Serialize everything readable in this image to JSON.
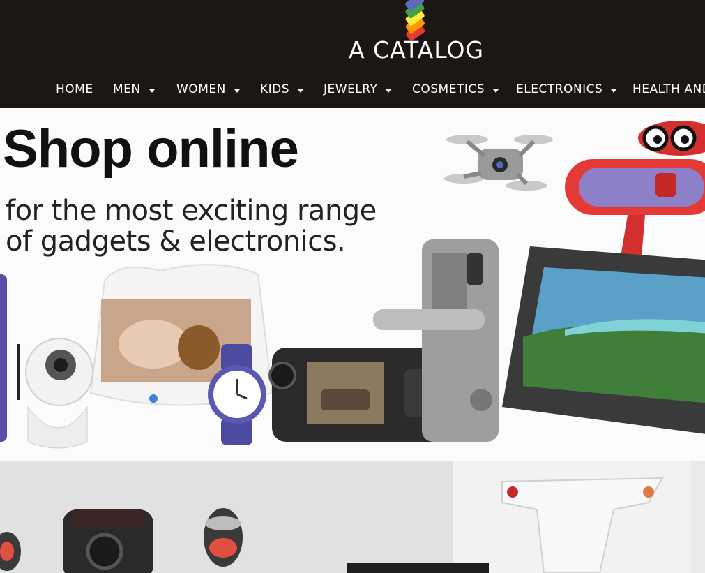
{
  "header": {
    "logo_text": "A CATALOG",
    "nav": [
      {
        "label": "HOME",
        "has_dropdown": false
      },
      {
        "label": "MEN",
        "has_dropdown": true
      },
      {
        "label": "WOMEN",
        "has_dropdown": true
      },
      {
        "label": "KIDS",
        "has_dropdown": true
      },
      {
        "label": "JEWELRY",
        "has_dropdown": true
      },
      {
        "label": "COSMETICS",
        "has_dropdown": true
      },
      {
        "label": "ELECTRONICS",
        "has_dropdown": true
      },
      {
        "label": "HEALTH AND",
        "has_dropdown": false
      }
    ]
  },
  "hero": {
    "title": "Shop online",
    "subtitle_line1": "for the most exciting range",
    "subtitle_line2": "of gadgets & electronics."
  },
  "colors": {
    "header_bg": "#1a1714",
    "logo_tags": [
      "#e53935",
      "#ff9800",
      "#ffeb3b",
      "#43a047",
      "#3f51b5"
    ]
  }
}
